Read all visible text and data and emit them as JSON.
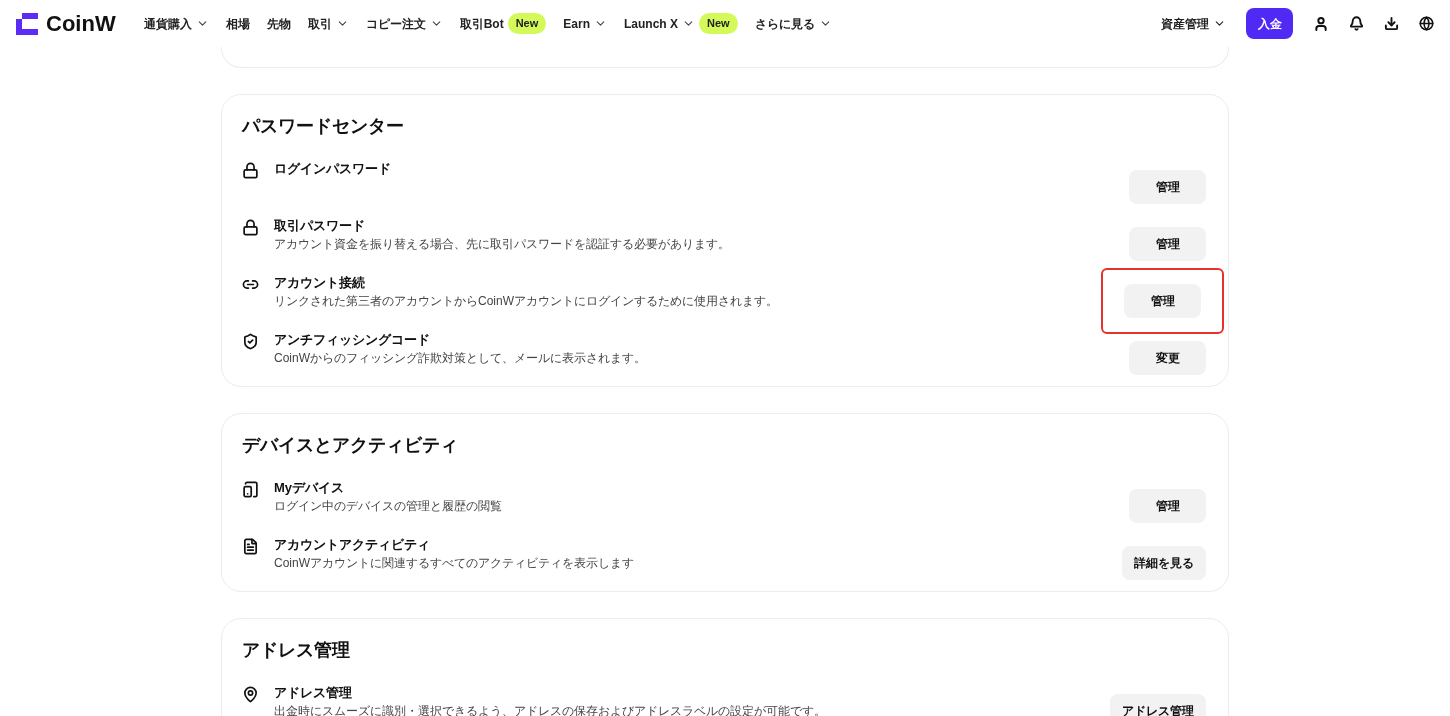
{
  "header": {
    "logo": "CoinW",
    "nav": [
      {
        "label": "通貨購入",
        "dropdown": true
      },
      {
        "label": "相場",
        "dropdown": false
      },
      {
        "label": "先物",
        "dropdown": false
      },
      {
        "label": "取引",
        "dropdown": true
      },
      {
        "label": "コピー注文",
        "dropdown": true
      },
      {
        "label": "取引Bot",
        "dropdown": false,
        "badge": "New"
      },
      {
        "label": "Earn",
        "dropdown": true
      },
      {
        "label": "Launch X",
        "dropdown": true,
        "badge": "New"
      },
      {
        "label": "さらに見る",
        "dropdown": true
      }
    ],
    "assets": {
      "label": "資産管理",
      "dropdown": true
    },
    "deposit": "入金"
  },
  "sections": [
    {
      "title": "パスワードセンター",
      "items": [
        {
          "title": "ログインパスワード",
          "button": "管理",
          "highlighted": false
        },
        {
          "title": "取引パスワード",
          "description": "アカウント資金を振り替える場合、先に取引パスワードを認証する必要があります。",
          "button": "管理",
          "highlighted": false
        },
        {
          "title": "アカウント接続",
          "description": "リンクされた第三者のアカウントからCoinWアカウントにログインするために使用されます。",
          "button": "管理",
          "highlighted": true
        },
        {
          "title": "アンチフィッシングコード",
          "description": "CoinWからのフィッシング詐欺対策として、メールに表示されます。",
          "button": "変更",
          "highlighted": false
        }
      ]
    },
    {
      "title": "デバイスとアクティビティ",
      "items": [
        {
          "title": "Myデバイス",
          "description": "ログイン中のデバイスの管理と履歴の閲覧",
          "button": "管理",
          "highlighted": false
        },
        {
          "title": "アカウントアクティビティ",
          "description": "CoinWアカウントに関連するすべてのアクティビティを表示します",
          "button": "詳細を見る",
          "highlighted": false
        }
      ]
    },
    {
      "title": "アドレス管理",
      "items": [
        {
          "title": "アドレス管理",
          "description": "出金時にスムーズに識別・選択できるよう、アドレスの保存およびアドレスラベルの設定が可能です。",
          "button": "アドレス管理",
          "highlighted": false
        }
      ]
    }
  ]
}
